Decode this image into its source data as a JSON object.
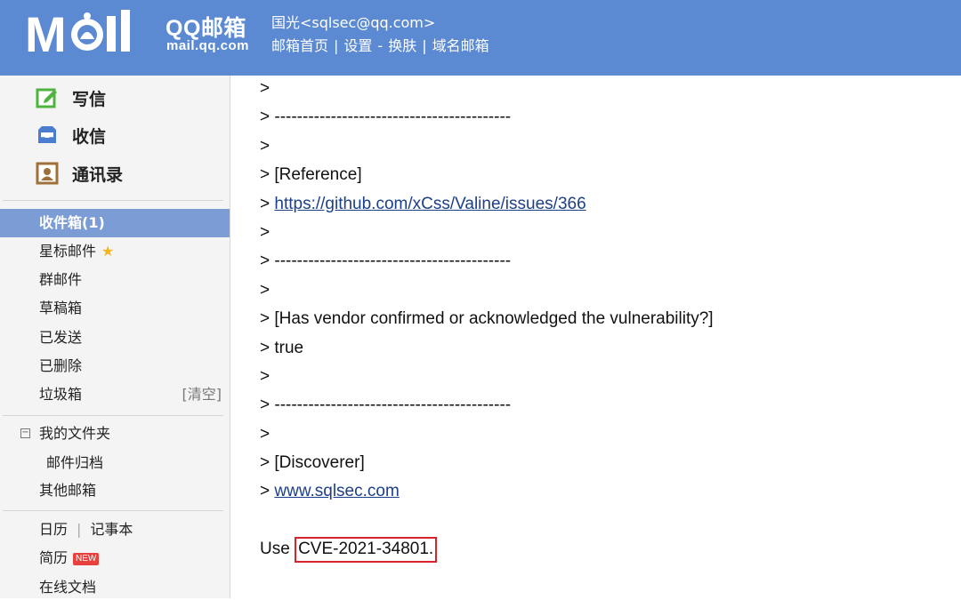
{
  "header": {
    "logo_text": "M◎il",
    "brand": "QQ邮箱",
    "domain": "mail.qq.com",
    "user": "国光<sqlsec@qq.com>",
    "nav": [
      "邮箱首页",
      "设置",
      "换肤",
      "域名邮箱"
    ],
    "nav_seps": [
      "|",
      "-",
      "|"
    ]
  },
  "sidebar": {
    "quick": [
      {
        "label": "写信",
        "icon": "compose-icon"
      },
      {
        "label": "收信",
        "icon": "inbox-tray-icon"
      },
      {
        "label": "通讯录",
        "icon": "contacts-icon"
      }
    ],
    "folders": [
      {
        "label": "收件箱(1)",
        "active": true
      },
      {
        "label": "星标邮件"
      },
      {
        "label": "群邮件"
      },
      {
        "label": "草稿箱"
      },
      {
        "label": "已发送"
      },
      {
        "label": "已删除"
      },
      {
        "label": "垃圾箱",
        "action": "[清空]"
      }
    ],
    "my_folders": {
      "toggle": "⊟",
      "label": "我的文件夹",
      "children": [
        "邮件归档"
      ]
    },
    "other_mailbox": "其他邮箱",
    "tools": {
      "calendar": "日历",
      "sep": "|",
      "notes": "记事本",
      "resume": "简历",
      "new_badge": "NEW",
      "docs": "在线文档"
    },
    "colors": {
      "active_bg": "#7b9cd4",
      "header_bg": "#5b8ad2"
    }
  },
  "email": {
    "lines": [
      ">",
      "> ------------------------------------------",
      ">",
      "> [Reference]",
      {
        "prefix": "> ",
        "link": "https://github.com/xCss/Valine/issues/366"
      },
      ">",
      "> ------------------------------------------",
      ">",
      "> [Has vendor confirmed or acknowledged the vulnerability?]",
      "> true",
      ">",
      "> ------------------------------------------",
      ">",
      "> [Discoverer]",
      {
        "prefix": "> ",
        "link": "www.sqlsec.com"
      }
    ],
    "footer_prefix": "Use ",
    "footer_highlight": "CVE-2021-34801",
    "footer_suffix": "."
  }
}
